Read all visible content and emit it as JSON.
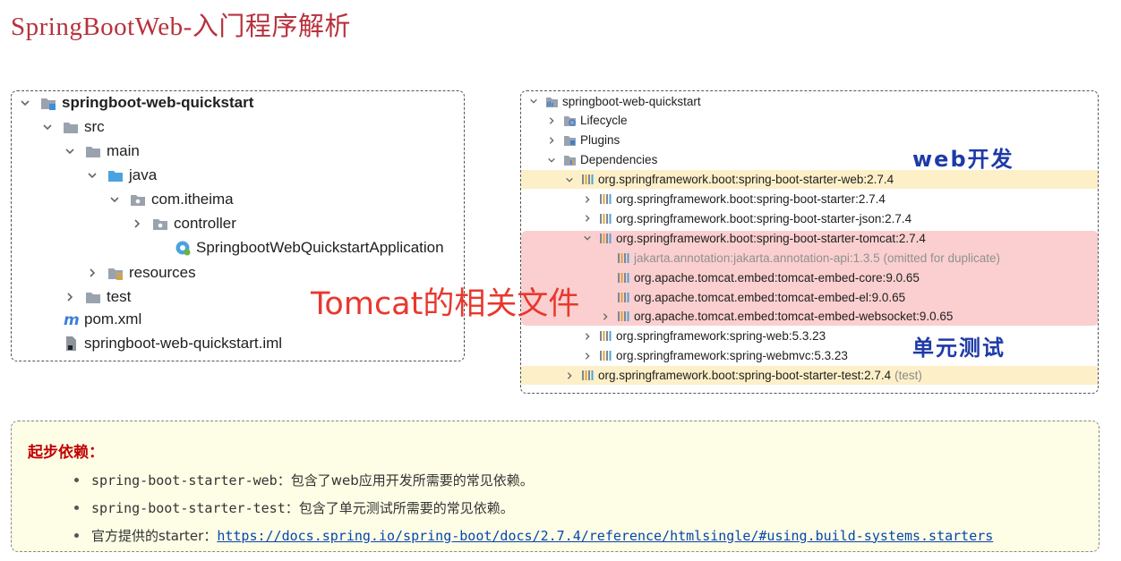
{
  "page": {
    "title": "SpringBootWeb-入门程序解析"
  },
  "project_tree": {
    "items": [
      {
        "label": "springboot-web-quickstart",
        "level": 0,
        "arrow": "down",
        "icon": "module-folder-icon",
        "bold": true
      },
      {
        "label": "src",
        "level": 1,
        "arrow": "down",
        "icon": "folder-icon"
      },
      {
        "label": "main",
        "level": 2,
        "arrow": "down",
        "icon": "folder-icon"
      },
      {
        "label": "java",
        "level": 3,
        "arrow": "down",
        "icon": "source-folder-icon"
      },
      {
        "label": "com.itheima",
        "level": 4,
        "arrow": "down",
        "icon": "package-icon"
      },
      {
        "label": "controller",
        "level": 5,
        "arrow": "right",
        "icon": "package-icon"
      },
      {
        "label": "SpringbootWebQuickstartApplication",
        "level": 6,
        "arrow": "none",
        "icon": "spring-class-icon"
      },
      {
        "label": "resources",
        "level": 3,
        "arrow": "right",
        "icon": "resources-folder-icon"
      },
      {
        "label": "test",
        "level": 2,
        "arrow": "right",
        "icon": "folder-icon"
      },
      {
        "label": "pom.xml",
        "level": 1,
        "arrow": "none",
        "icon": "maven-icon"
      },
      {
        "label": "springboot-web-quickstart.iml",
        "level": 1,
        "arrow": "none",
        "icon": "iml-file-icon"
      }
    ]
  },
  "maven_panel": {
    "items": [
      {
        "label": "springboot-web-quickstart",
        "level": 0,
        "arrow": "down",
        "icon": "maven-project-icon"
      },
      {
        "label": "Lifecycle",
        "level": 1,
        "arrow": "right",
        "icon": "lifecycle-icon"
      },
      {
        "label": "Plugins",
        "level": 1,
        "arrow": "right",
        "icon": "plugins-icon"
      },
      {
        "label": "Dependencies",
        "level": 1,
        "arrow": "down",
        "icon": "dependencies-icon"
      },
      {
        "label": "org.springframework.boot:spring-boot-starter-web:2.7.4",
        "level": 2,
        "arrow": "down",
        "icon": "library-icon",
        "highlight": true
      },
      {
        "label": "org.springframework.boot:spring-boot-starter:2.7.4",
        "level": 3,
        "arrow": "right",
        "icon": "library-icon"
      },
      {
        "label": "org.springframework.boot:spring-boot-starter-json:2.7.4",
        "level": 3,
        "arrow": "right",
        "icon": "library-icon"
      },
      {
        "label": "org.springframework.boot:spring-boot-starter-tomcat:2.7.4",
        "level": 3,
        "arrow": "down",
        "icon": "library-icon"
      },
      {
        "label": "jakarta.annotation:jakarta.annotation-api:1.3.5 (omitted for duplicate)",
        "level": 4,
        "arrow": "none",
        "icon": "library-icon",
        "grey": true
      },
      {
        "label": "org.apache.tomcat.embed:tomcat-embed-core:9.0.65",
        "level": 4,
        "arrow": "none",
        "icon": "library-icon"
      },
      {
        "label": "org.apache.tomcat.embed:tomcat-embed-el:9.0.65",
        "level": 4,
        "arrow": "none",
        "icon": "library-icon"
      },
      {
        "label": "org.apache.tomcat.embed:tomcat-embed-websocket:9.0.65",
        "level": 4,
        "arrow": "right",
        "icon": "library-icon"
      },
      {
        "label": "org.springframework:spring-web:5.3.23",
        "level": 3,
        "arrow": "right",
        "icon": "library-icon"
      },
      {
        "label": "org.springframework:spring-webmvc:5.3.23",
        "level": 3,
        "arrow": "right",
        "icon": "library-icon"
      },
      {
        "label": "org.springframework.boot:spring-boot-starter-test:2.7.4",
        "level": 2,
        "arrow": "right",
        "icon": "library-icon",
        "highlight": true,
        "scope": "(test)"
      }
    ]
  },
  "annotations": {
    "web_dev": "web开发",
    "unit_test": "单元测试",
    "tomcat_files": "Tomcat的相关文件"
  },
  "info_box": {
    "title": "起步依赖：",
    "bullets": [
      {
        "code": "spring-boot-starter-web",
        "text": "：包含了web应用开发所需要的常见依赖。"
      },
      {
        "code": "spring-boot-starter-test",
        "text": "：包含了单元测试所需要的常见依赖。"
      },
      {
        "code": "",
        "text": "官方提供的starter：",
        "link": "https://docs.spring.io/spring-boot/docs/2.7.4/reference/htmlsingle/#using.build-systems.starters"
      }
    ]
  },
  "colors": {
    "title_red": "#b8313d",
    "annotation_blue": "#1e3aa8",
    "tomcat_red": "#e8382e",
    "highlight_yellow": "#fdf0c9",
    "highlight_red": "#fbcfcf"
  }
}
